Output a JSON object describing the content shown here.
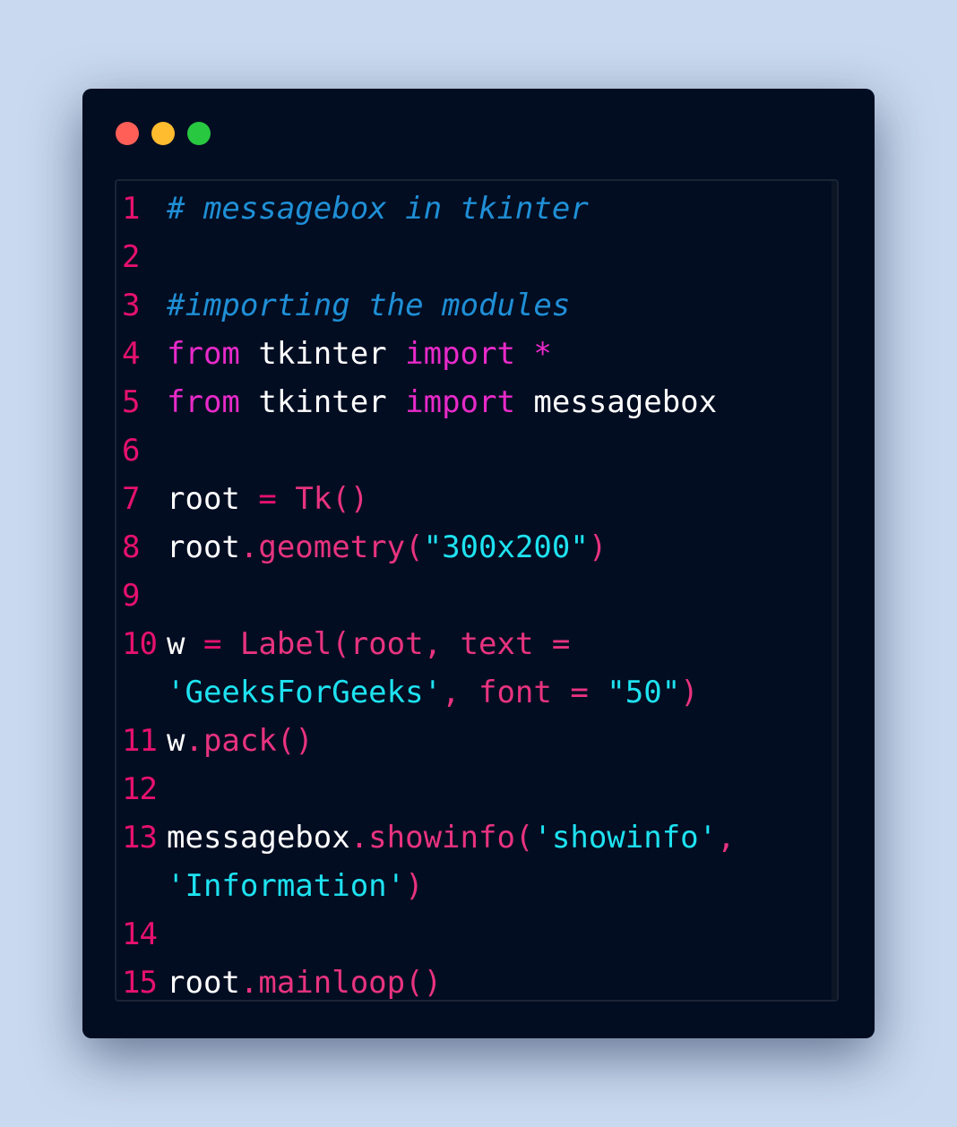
{
  "window": {
    "controls": [
      {
        "name": "close",
        "color": "#ff5f57"
      },
      {
        "name": "minimize",
        "color": "#febc2e"
      },
      {
        "name": "maximize",
        "color": "#28c840"
      }
    ]
  },
  "theme": {
    "line_number": "#e6116e",
    "comment": "#1f8fd6",
    "keyword": "#e82ac9",
    "identifier": "#ffffff",
    "operator": "#e6116e",
    "call": "#e8337f",
    "string": "#1ee2f0"
  },
  "code": {
    "lines": [
      {
        "number": "1",
        "tokens": [
          {
            "text": "# messagebox in tkinter",
            "kind": "comment"
          }
        ]
      },
      {
        "number": "2",
        "tokens": []
      },
      {
        "number": "3",
        "tokens": [
          {
            "text": "#importing the modules",
            "kind": "comment"
          }
        ]
      },
      {
        "number": "4",
        "tokens": [
          {
            "text": "from",
            "kind": "keyword"
          },
          {
            "text": " tkinter ",
            "kind": "identifier"
          },
          {
            "text": "import",
            "kind": "keyword"
          },
          {
            "text": " *",
            "kind": "keyword"
          }
        ]
      },
      {
        "number": "5",
        "tokens": [
          {
            "text": "from",
            "kind": "keyword"
          },
          {
            "text": " tkinter ",
            "kind": "identifier"
          },
          {
            "text": "import",
            "kind": "keyword"
          },
          {
            "text": " messagebox",
            "kind": "identifier"
          }
        ]
      },
      {
        "number": "6",
        "tokens": []
      },
      {
        "number": "7",
        "tokens": [
          {
            "text": "root",
            "kind": "identifier"
          },
          {
            "text": " = ",
            "kind": "operator"
          },
          {
            "text": "Tk()",
            "kind": "call"
          }
        ]
      },
      {
        "number": "8",
        "tokens": [
          {
            "text": "root",
            "kind": "identifier"
          },
          {
            "text": ".geometry(",
            "kind": "call"
          },
          {
            "text": "\"300x200\"",
            "kind": "string"
          },
          {
            "text": ")",
            "kind": "call"
          }
        ]
      },
      {
        "number": "9",
        "tokens": []
      },
      {
        "number": "10",
        "tokens": [
          {
            "text": "w",
            "kind": "identifier"
          },
          {
            "text": " = ",
            "kind": "operator"
          },
          {
            "text": "Label(root, text =",
            "kind": "call"
          }
        ]
      },
      {
        "number": "",
        "tokens": [
          {
            "text": "'GeeksForGeeks'",
            "kind": "string"
          },
          {
            "text": ", font = ",
            "kind": "call"
          },
          {
            "text": "\"50\"",
            "kind": "string"
          },
          {
            "text": ")",
            "kind": "call"
          }
        ]
      },
      {
        "number": "11",
        "tokens": [
          {
            "text": "w",
            "kind": "identifier"
          },
          {
            "text": ".pack()",
            "kind": "call"
          }
        ]
      },
      {
        "number": "12",
        "tokens": []
      },
      {
        "number": "13",
        "tokens": [
          {
            "text": "messagebox",
            "kind": "identifier"
          },
          {
            "text": ".showinfo(",
            "kind": "call"
          },
          {
            "text": "'showinfo'",
            "kind": "string"
          },
          {
            "text": ",",
            "kind": "call"
          }
        ]
      },
      {
        "number": "",
        "tokens": [
          {
            "text": "'Information'",
            "kind": "string"
          },
          {
            "text": ")",
            "kind": "call"
          }
        ]
      },
      {
        "number": "14",
        "tokens": []
      },
      {
        "number": "15",
        "tokens": [
          {
            "text": "root",
            "kind": "identifier"
          },
          {
            "text": ".mainloop()",
            "kind": "call"
          }
        ]
      }
    ]
  }
}
